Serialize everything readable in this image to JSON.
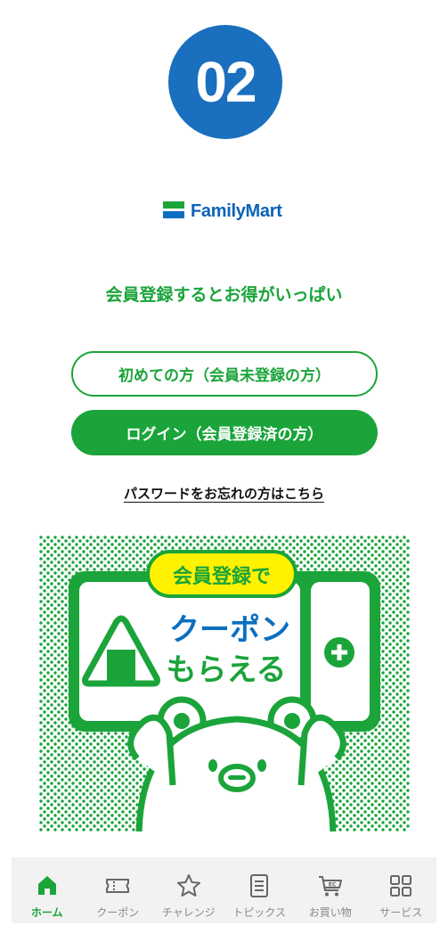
{
  "step": {
    "number": "02"
  },
  "logo": {
    "text": "FamilyMart"
  },
  "tagline": "会員登録するとお得がいっぱい",
  "buttons": {
    "new_member": "初めての方（会員未登録の方）",
    "login": "ログイン（会員登録済の方）"
  },
  "password_link": "パスワードをお忘れの方はこちら",
  "banner": {
    "badge": "会員登録で",
    "line1": "クーポン",
    "line2": "もらえる"
  },
  "tabbar": {
    "items": [
      {
        "label": "ホーム",
        "icon": "home-icon",
        "active": true
      },
      {
        "label": "クーポン",
        "icon": "coupon-icon"
      },
      {
        "label": "チャレンジ",
        "icon": "star-icon"
      },
      {
        "label": "トピックス",
        "icon": "document-icon"
      },
      {
        "label": "お買い物",
        "icon": "ec-cart-icon"
      },
      {
        "label": "サービス",
        "icon": "grid-icon"
      }
    ]
  },
  "colors": {
    "green": "#1aa43a",
    "blue": "#1a6fbf",
    "yellow": "#fff200"
  }
}
